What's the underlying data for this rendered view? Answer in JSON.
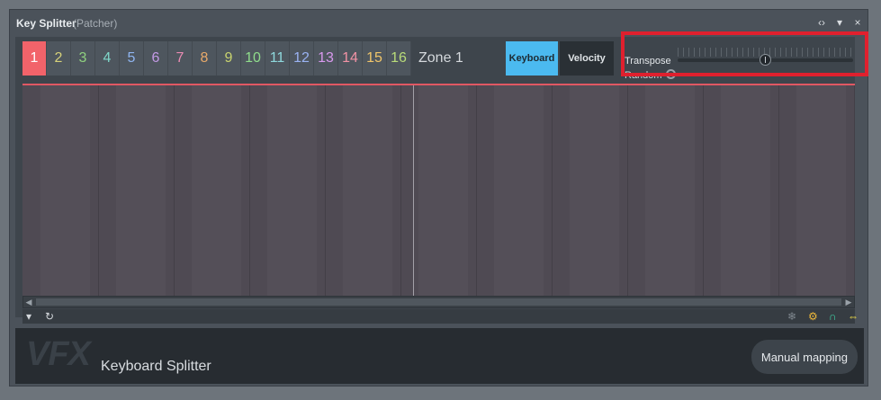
{
  "window": {
    "title": "Key Splitter",
    "subtitle": "(Patcher)"
  },
  "zones": [
    {
      "label": "1",
      "color": "#ffffff",
      "active": true
    },
    {
      "label": "2",
      "color": "#d6d17a"
    },
    {
      "label": "3",
      "color": "#8fd07f"
    },
    {
      "label": "4",
      "color": "#7fd7c9"
    },
    {
      "label": "5",
      "color": "#8fb5f0"
    },
    {
      "label": "6",
      "color": "#c39ae6"
    },
    {
      "label": "7",
      "color": "#e98bb3"
    },
    {
      "label": "8",
      "color": "#e8a96a"
    },
    {
      "label": "9",
      "color": "#c9d36f"
    },
    {
      "label": "10",
      "color": "#8fdc8b"
    },
    {
      "label": "11",
      "color": "#8ed8dc"
    },
    {
      "label": "12",
      "color": "#9ab3f3"
    },
    {
      "label": "13",
      "color": "#d899ee"
    },
    {
      "label": "14",
      "color": "#f293a5"
    },
    {
      "label": "15",
      "color": "#f0c56a"
    },
    {
      "label": "16",
      "color": "#b9dc7a"
    }
  ],
  "zone_label": "Zone 1",
  "modes": {
    "keyboard": "Keyboard",
    "velocity": "Velocity",
    "selected": "Keyboard"
  },
  "transpose": {
    "label": "Transpose",
    "value_fraction": 0.5
  },
  "random": {
    "label": "Random"
  },
  "footer": {
    "brand": "VFX",
    "product": "Keyboard Splitter",
    "manual_button": "Manual mapping"
  },
  "colors": {
    "accent": "#4bbaf0",
    "active_zone": "#f2636a",
    "highlight": "#e0202e"
  },
  "icons": [
    "dropdown-arrow-icon",
    "refresh-icon",
    "snowflake-icon",
    "tag-icon",
    "magnet-icon",
    "arrows-horizontal-icon"
  ]
}
